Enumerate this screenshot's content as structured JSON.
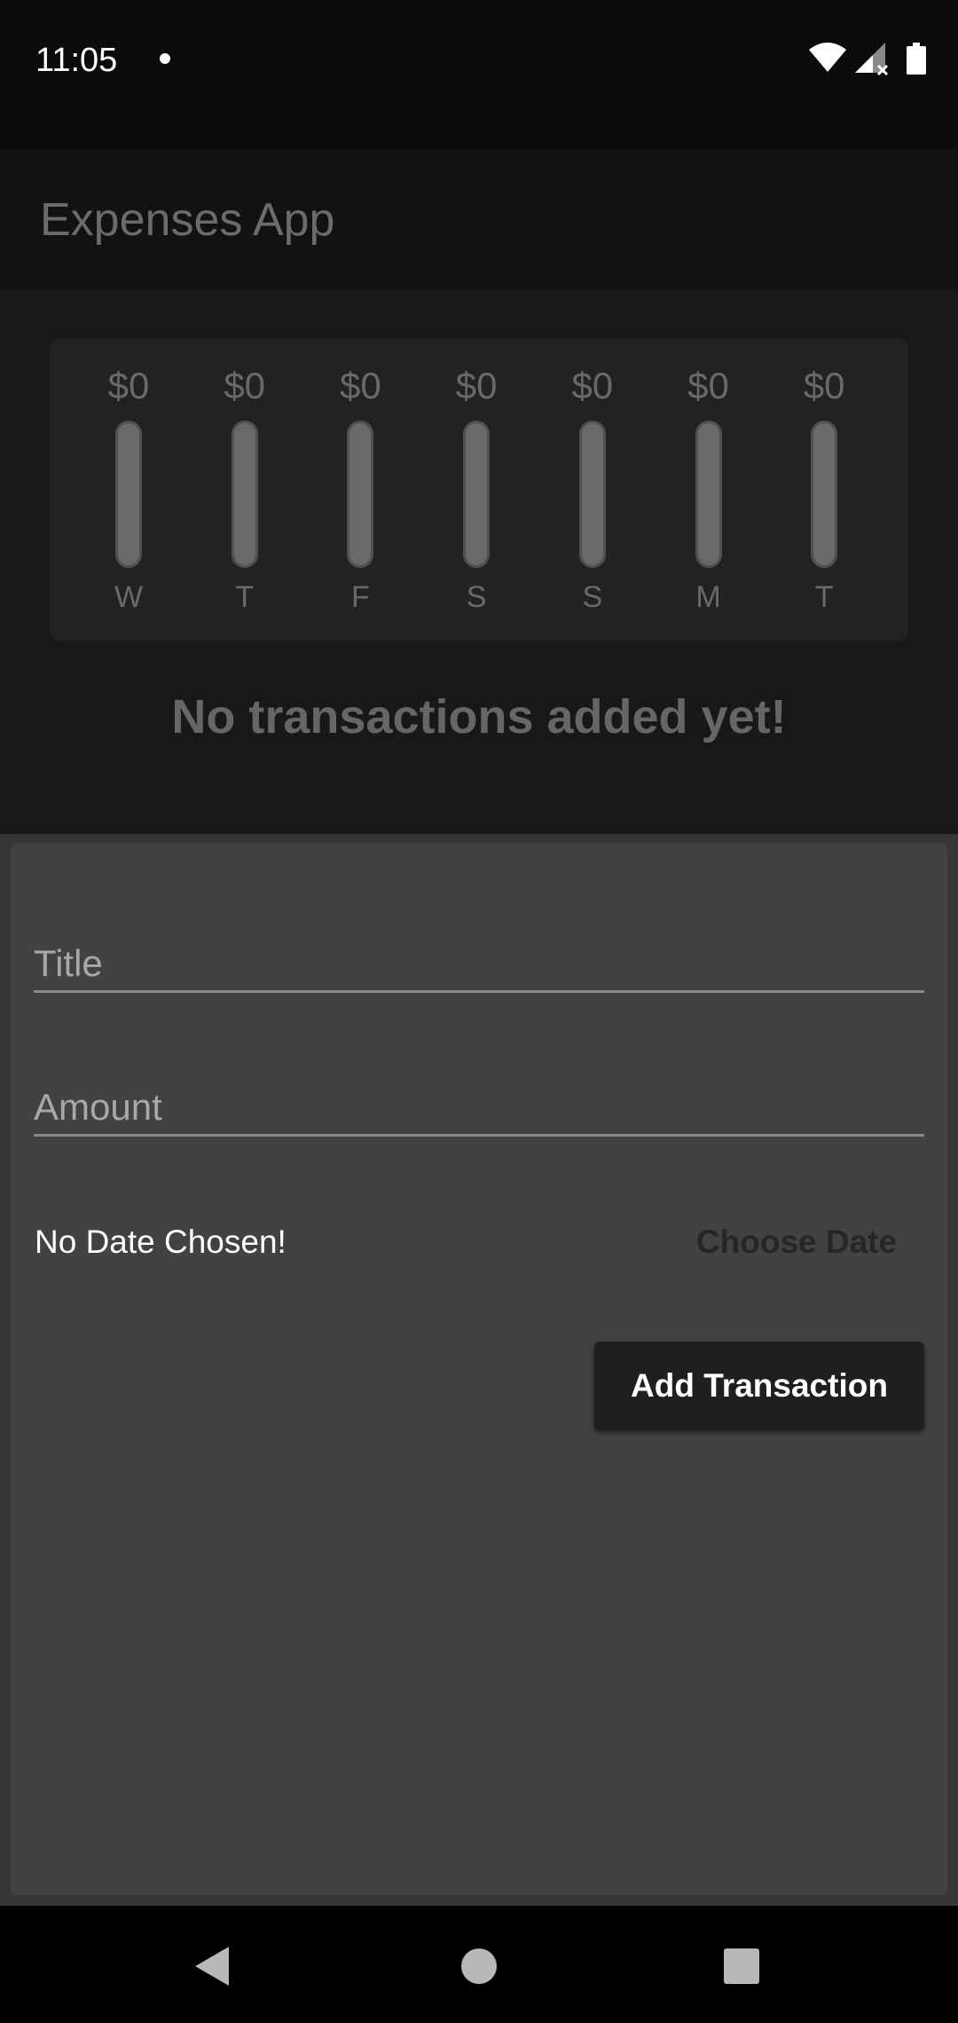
{
  "status_bar": {
    "time": "11:05",
    "icons": [
      "notification-dot-icon",
      "wifi-icon",
      "cell-signal-icon",
      "battery-icon"
    ]
  },
  "app_bar": {
    "title": "Expenses App"
  },
  "chart": {
    "days": [
      {
        "amount": "$0",
        "day": "W"
      },
      {
        "amount": "$0",
        "day": "T"
      },
      {
        "amount": "$0",
        "day": "F"
      },
      {
        "amount": "$0",
        "day": "S"
      },
      {
        "amount": "$0",
        "day": "S"
      },
      {
        "amount": "$0",
        "day": "M"
      },
      {
        "amount": "$0",
        "day": "T"
      }
    ],
    "spending_fraction": [
      0,
      0,
      0,
      0,
      0,
      0,
      0
    ]
  },
  "empty_message": "No transactions added yet!",
  "form": {
    "title_placeholder": "Title",
    "title_value": "",
    "amount_placeholder": "Amount",
    "amount_value": "",
    "date_label": "No Date Chosen!",
    "choose_date_label": "Choose Date",
    "submit_label": "Add Transaction"
  },
  "nav_bar": {
    "icons": [
      "back-icon",
      "home-icon",
      "recents-icon"
    ]
  },
  "colors": {
    "background": "#181818",
    "sheet": "#424242",
    "bar_fill": "#696969",
    "button": "#1f1f1f"
  }
}
